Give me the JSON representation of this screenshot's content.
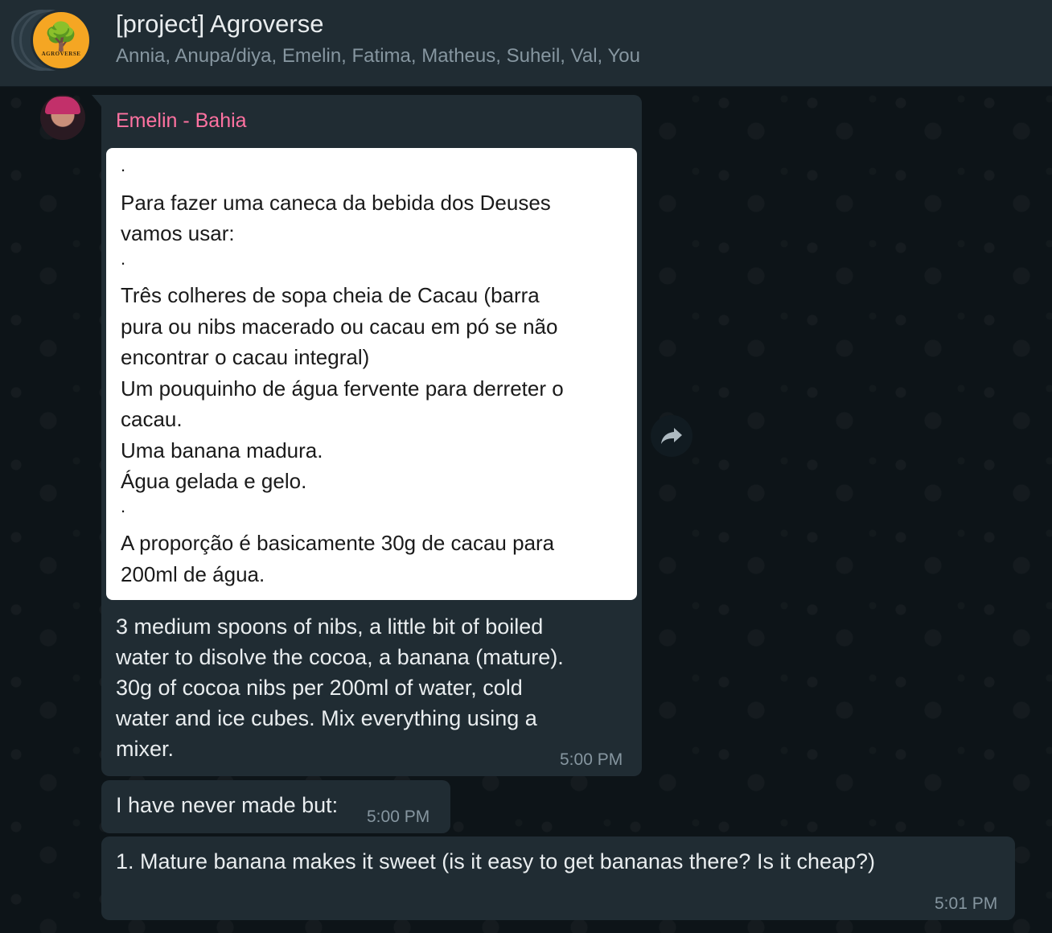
{
  "header": {
    "title": "[project] Agroverse",
    "members": "Annia, Anupa/diya, Emelin, Fatima, Matheus, Suheil, Val, You",
    "avatar_logo_text": "AGROVERSE"
  },
  "messages": {
    "main": {
      "sender": "Emelin - Bahia",
      "image_lines": [
        ".",
        "Para fazer uma caneca da bebida dos Deuses",
        "vamos usar:",
        ".",
        "Três colheres de sopa cheia de Cacau (barra",
        "pura ou nibs macerado ou cacau em pó se não",
        "encontrar o cacau integral)",
        "Um pouquinho de água fervente para derreter o",
        "cacau.",
        "Uma banana madura.",
        "Água gelada e gelo.",
        ".",
        "A proporção é basicamente 30g de cacau para",
        "200ml de água.",
        "."
      ],
      "caption_lines": [
        "3 medium spoons of nibs, a little bit of boiled",
        "water to disolve the cocoa, a banana (mature).",
        "30g of cocoa nibs per 200ml of water, cold",
        "water and ice cubes. Mix everything using a",
        "mixer."
      ],
      "time": "5:00 PM"
    },
    "short": {
      "text": "I have never made but:",
      "time": "5:00 PM"
    },
    "question": {
      "text": "1. Mature banana makes it sweet (is it easy to get bananas there? Is it cheap?)",
      "time": "5:01 PM"
    }
  },
  "icons": {
    "forward": "forward-arrow-icon",
    "group_avatar": "tree-logo-icon"
  },
  "colors": {
    "background": "#0b141a",
    "bubble": "#202c33",
    "sender_name": "#ff72a1",
    "meta_text": "#8696a0"
  }
}
